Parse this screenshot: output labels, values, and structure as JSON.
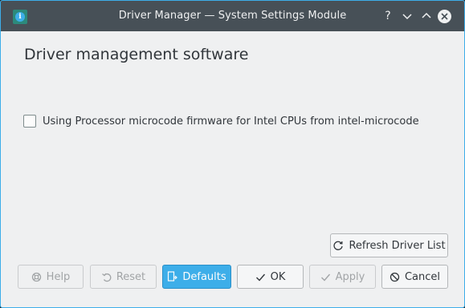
{
  "window": {
    "title": "Driver Manager — System Settings Module"
  },
  "titlebar": {
    "help_glyph": "?",
    "minimize_glyph": "⌄",
    "maximize_glyph": "⌃"
  },
  "main": {
    "heading": "Driver management software",
    "drivers": [
      {
        "label": "Using Processor microcode firmware for Intel CPUs from intel-microcode",
        "checked": false
      }
    ],
    "refresh_button": "Refresh Driver List"
  },
  "footer": {
    "help_button": "Help",
    "reset_button": "Reset",
    "defaults_button": "Defaults",
    "ok_button": "OK",
    "apply_button": "Apply",
    "cancel_button": "Cancel"
  },
  "colors": {
    "accent": "#3daee9",
    "titlebar": "#475057",
    "background": "#eff0f1"
  },
  "icons": {
    "app": "info-icon",
    "refresh": "refresh-icon",
    "help": "help-lifebuoy-icon",
    "reset": "undo-icon",
    "defaults": "defaults-document-icon",
    "ok": "checkmark-icon",
    "apply": "checkmark-icon",
    "cancel": "cancel-circle-icon"
  }
}
